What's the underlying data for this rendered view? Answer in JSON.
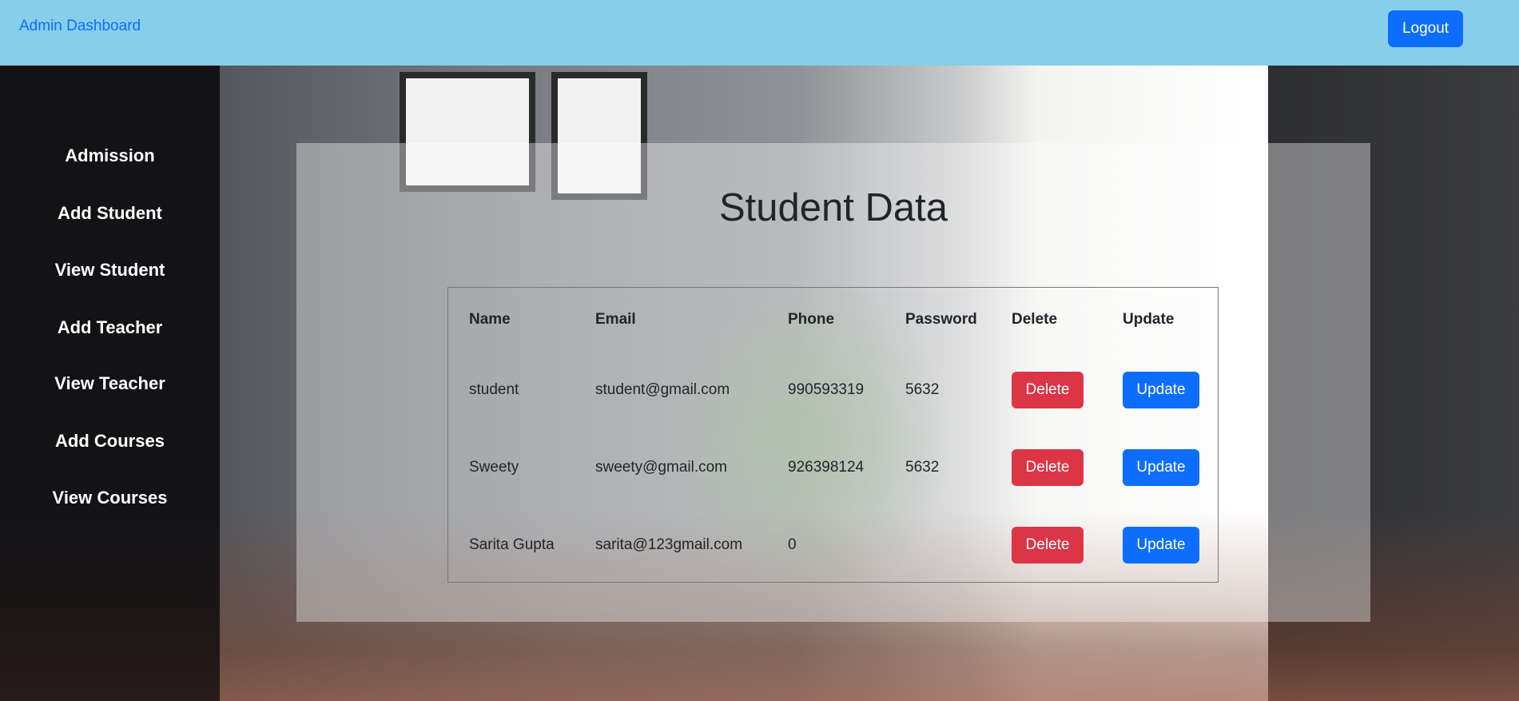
{
  "header": {
    "brand": "Admin Dashboard",
    "logout_label": "Logout"
  },
  "sidebar": {
    "items": [
      "Admission",
      "Add Student",
      "View Student",
      "Add Teacher",
      "View Teacher",
      "Add Courses",
      "View Courses"
    ]
  },
  "main": {
    "title": "Student Data",
    "columns": [
      "Name",
      "Email",
      "Phone",
      "Password",
      "Delete",
      "Update"
    ],
    "rows": [
      {
        "name": "student",
        "email": "student@gmail.com",
        "phone": "990593319",
        "password": "5632",
        "delete": "Delete",
        "update": "Update"
      },
      {
        "name": "Sweety",
        "email": "sweety@gmail.com",
        "phone": "926398124",
        "password": "5632",
        "delete": "Delete",
        "update": "Update"
      },
      {
        "name": "Sarita Gupta",
        "email": "sarita@123gmail.com",
        "phone": "0",
        "password": "",
        "delete": "Delete",
        "update": "Update"
      }
    ]
  },
  "colors": {
    "header_bg": "#87ceeb",
    "primary": "#0d6efd",
    "danger": "#dc3545"
  }
}
